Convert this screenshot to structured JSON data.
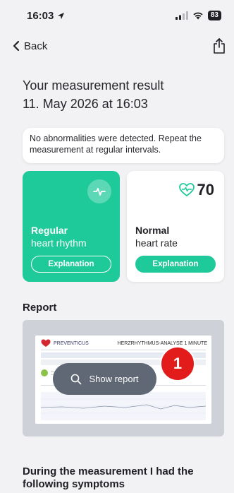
{
  "status_bar": {
    "time": "16:03",
    "battery": "83"
  },
  "nav": {
    "back_label": "Back"
  },
  "result": {
    "title": "Your measurement result",
    "datetime": "11. May 2026 at 16:03"
  },
  "notice": "No abnormalities were detected. Repeat the measurement at regular intervals.",
  "rhythm_card": {
    "title": "Regular",
    "subtitle": "heart rhythm",
    "button_label": "Explanation"
  },
  "rate_card": {
    "value": "70",
    "title": "Normal",
    "subtitle": "heart rate",
    "button_label": "Explanation"
  },
  "report": {
    "section_title": "Report",
    "thumbnail": {
      "brand": "PREVENTICUS",
      "heading": "HERZRHYTHMUS-ANALYSE 1 MINUTE"
    },
    "show_label": "Show report"
  },
  "annotation": {
    "badge": "1"
  },
  "symptoms": {
    "title": "During the measurement I had the following symptoms"
  },
  "colors": {
    "accent": "#1ec99a",
    "badge": "#e21b1b",
    "pill": "#5f6874"
  }
}
